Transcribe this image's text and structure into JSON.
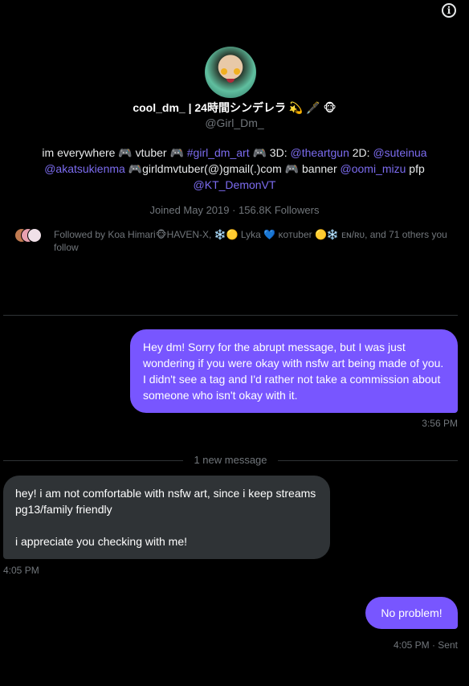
{
  "profile": {
    "display_name": "cool_dm_ | 24時間シンデレラ 💫 🖋️ 🐵",
    "handle": "@Girl_Dm_",
    "bio": {
      "line1_a": "im everywhere 🎮 vtuber 🎮 ",
      "hashtag": "#girl_dm_art",
      "line1_b": " 🎮 3D: ",
      "mention_3d": "@theartgun",
      "line1_c": " 2D: ",
      "mention_2d": "@suteinua",
      "mention_2d_b": "@akatsukienma",
      "line2_a": " 🎮girldmvtuber(@)gmail(.)com 🎮 banner ",
      "mention_banner": "@oomi_mizu",
      "line2_b": " pfp",
      "mention_pfp": "@KT_DemonVT"
    },
    "joined": "Joined May 2019 · 156.8K Followers",
    "followed_by": "Followed by Koa Himari🐵HAVEN-X, ❄️🟡 Lyka 💙 ᴋᴏᴛuber 🟡❄️ ᴇɴ/ʀᴜ, and 71 others you follow"
  },
  "header": {
    "info_icon": "info-icon",
    "info_glyph": "i"
  },
  "messages": [
    {
      "direction": "out",
      "text": "Hey dm! Sorry for the abrupt message, but I was just wondering if you were okay with nsfw art being made of you. I didn't see a tag and I'd rather not take a commission about someone who isn't okay with it.",
      "time": "3:56 PM"
    },
    {
      "direction": "in",
      "text_line1": "hey! i am not comfortable with nsfw art, since i keep streams pg13/family friendly",
      "text_line2": "i appreciate you checking with me!",
      "time": "4:05 PM"
    },
    {
      "direction": "out",
      "text": "No problem!",
      "time": "4:05 PM · Sent"
    }
  ],
  "new_message_label": "1 new message",
  "colors": {
    "background": "#000000",
    "outgoing_bubble": "#7856ff",
    "incoming_bubble": "#2f3336",
    "link": "#7c6cf0",
    "muted_text": "#71767b"
  }
}
